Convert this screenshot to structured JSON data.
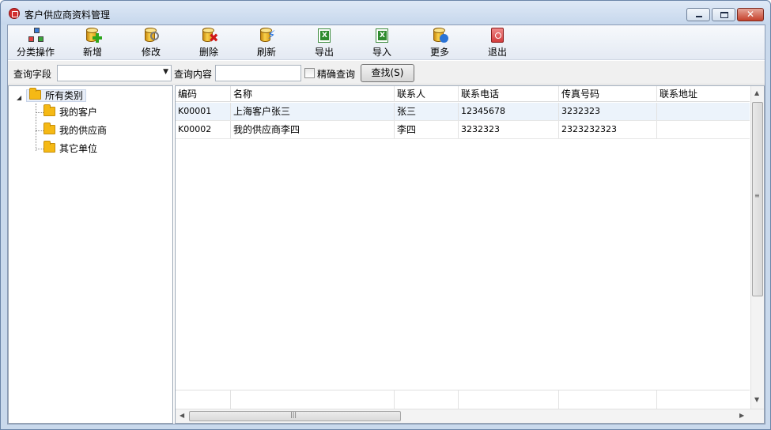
{
  "window": {
    "title": "客户供应商资料管理",
    "controls": {
      "minimize": "minimize",
      "maximize": "maximize",
      "close": "✕"
    }
  },
  "toolbar": {
    "items": [
      {
        "label": "分类操作",
        "icon": "category-icon"
      },
      {
        "label": "新增",
        "icon": "add-icon"
      },
      {
        "label": "修改",
        "icon": "edit-icon"
      },
      {
        "label": "删除",
        "icon": "delete-icon"
      },
      {
        "label": "刷新",
        "icon": "refresh-icon"
      },
      {
        "label": "导出",
        "icon": "export-excel-icon"
      },
      {
        "label": "导入",
        "icon": "import-excel-icon"
      },
      {
        "label": "更多",
        "icon": "more-icon"
      },
      {
        "label": "退出",
        "icon": "exit-icon"
      }
    ]
  },
  "search": {
    "field_label": "查询字段",
    "field_value": "",
    "content_label": "查询内容",
    "content_value": "",
    "exact_label": "精确查询",
    "exact_checked": false,
    "find_button": "查找(S)"
  },
  "tree": {
    "root": "所有类别",
    "children": [
      "我的客户",
      "我的供应商",
      "其它单位"
    ]
  },
  "grid": {
    "columns": [
      "编码",
      "名称",
      "联系人",
      "联系电话",
      "传真号码",
      "联系地址"
    ],
    "rows": [
      [
        "K00001",
        "上海客户张三",
        "张三",
        "12345678",
        "3232323",
        ""
      ],
      [
        "K00002",
        "我的供应商李四",
        "李四",
        "3232323",
        "2323232323",
        ""
      ]
    ]
  },
  "colors": {
    "title_bar": "#c6d7ec",
    "selected_row": "#ecf3fb",
    "close_button": "#c5402a"
  }
}
